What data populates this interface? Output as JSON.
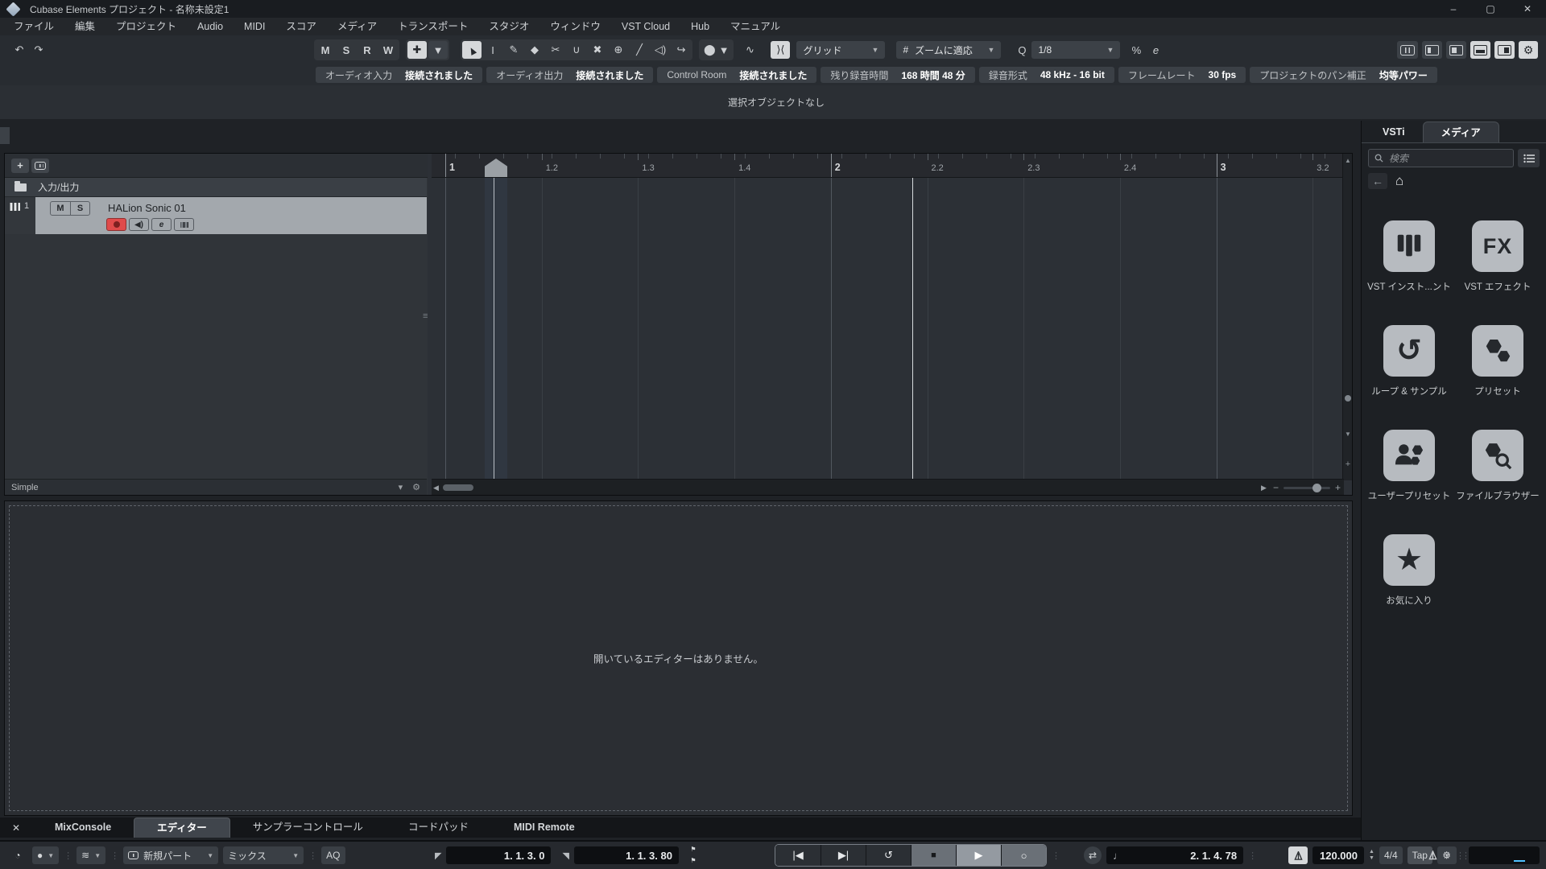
{
  "window": {
    "title": "Cubase Elements プロジェクト - 名称未設定1",
    "minimize": "–",
    "maximize": "▢",
    "close": "✕"
  },
  "menu": {
    "items": [
      "ファイル",
      "編集",
      "プロジェクト",
      "Audio",
      "MIDI",
      "スコア",
      "メディア",
      "トランスポート",
      "スタジオ",
      "ウィンドウ",
      "VST Cloud",
      "Hub",
      "マニュアル"
    ]
  },
  "toolbar": {
    "undo": "↶",
    "redo": "↷",
    "msrw": [
      "M",
      "S",
      "R",
      "W"
    ],
    "autoscroll_glyph": "✚",
    "tools": [
      {
        "name": "object-select-tool",
        "glyph": "▲",
        "arrow": true,
        "active": true
      },
      {
        "name": "range-select-tool",
        "glyph": "I"
      },
      {
        "name": "draw-tool",
        "glyph": "✎"
      },
      {
        "name": "erase-tool",
        "glyph": "◆"
      },
      {
        "name": "split-tool",
        "glyph": "✂"
      },
      {
        "name": "glue-tool",
        "glyph": "∪"
      },
      {
        "name": "mute-tool",
        "glyph": "✖"
      },
      {
        "name": "zoom-tool",
        "glyph": "⊕"
      },
      {
        "name": "line-tool",
        "glyph": "╱"
      },
      {
        "name": "play-tool",
        "glyph": "◁)"
      },
      {
        "name": "scrub-tool",
        "glyph": "↪"
      }
    ],
    "color_menu_glyph": "⬤",
    "crossfade_glyph": "∿",
    "snap_glyph": "⟩⟨",
    "grid_type_label": "グリッド",
    "grid_interval_icon": "#",
    "grid_interval_label": "ズームに適応",
    "quantize_icon": "Q",
    "quantize_label": "1/8",
    "iterative_quantize": "%",
    "quantize_panel": "e",
    "zones": [
      {
        "name": "keyboard-zone-icon",
        "type": "kbd",
        "active": false
      },
      {
        "name": "left-zone-toggle",
        "type": "zone-l",
        "active": false
      },
      {
        "name": "left-zone-alt-toggle",
        "type": "zone-l2",
        "active": false
      },
      {
        "name": "lower-zone-toggle",
        "type": "zone-b",
        "active": true
      },
      {
        "name": "right-zone-toggle",
        "type": "zone-r",
        "active": true
      },
      {
        "name": "setup-window-layout",
        "type": "gear",
        "active": true
      }
    ]
  },
  "info_line": {
    "segments": [
      {
        "label": "オーディオ入力",
        "value": "接続されました"
      },
      {
        "label": "オーディオ出力",
        "value": "接続されました"
      },
      {
        "label": "Control Room",
        "value": "接続されました"
      },
      {
        "label": "残り録音時間",
        "value": "168 時間 48 分"
      },
      {
        "label": "録音形式",
        "value": "48 kHz - 16 bit"
      },
      {
        "label": "フレームレート",
        "value": "30 fps"
      },
      {
        "label": "プロジェクトのパン補正",
        "value": "均等パワー"
      }
    ],
    "status": "選択オブジェクトなし"
  },
  "left_zone": {
    "add_label": "+",
    "folder_label": "入力/出力",
    "track": {
      "number": "1",
      "name": "HALion Sonic 01",
      "mute": "M",
      "solo": "S",
      "edit": "e"
    },
    "footer_label": "Simple"
  },
  "ruler": {
    "ticks": [
      "1",
      "1.2",
      "1.3",
      "1.4",
      "2",
      "2.2",
      "2.3",
      "2.4",
      "3",
      "3.2"
    ]
  },
  "lower_zone": {
    "empty_text": "開いているエディターはありません。"
  },
  "bottom_tabs": {
    "close": "✕",
    "tabs": [
      {
        "label": "MixConsole",
        "bold": true
      },
      {
        "label": "エディター",
        "active": true
      },
      {
        "label": "サンプラーコントロール"
      },
      {
        "label": "コードパッド"
      },
      {
        "label": "MIDI Remote",
        "bold": true
      }
    ]
  },
  "right_zone": {
    "tabs": [
      {
        "label": "VSTi"
      },
      {
        "label": "メディア",
        "active": true
      }
    ],
    "search_placeholder": "検索",
    "tiles": [
      {
        "icon": "piano",
        "label": "VST インスト...ント"
      },
      {
        "icon": "fx",
        "label": "VST エフェクト"
      },
      {
        "icon": "loop",
        "label": "ループ & サンプル"
      },
      {
        "icon": "presets",
        "label": "プリセット"
      },
      {
        "icon": "user",
        "label": "ユーザープリセット"
      },
      {
        "icon": "browser",
        "label": "ファイルブラウザー"
      },
      {
        "icon": "star",
        "label": "お気に入り"
      }
    ]
  },
  "transport": {
    "constrain_glyph": "◔",
    "record_mode_glyph": "●",
    "audio_record_glyph": "≋",
    "midi_part_label": "新規パート",
    "midi_mix_label": "ミックス",
    "aq_label": "AQ",
    "left_locator": "1. 1. 3.   0",
    "right_locator": "1. 1. 3.  80",
    "prev": "|◀",
    "next": "▶|",
    "cycle": "↺",
    "stop": "■",
    "play": "▶",
    "record": "○",
    "exchange_glyph": "⇄",
    "note_glyph": "♩",
    "time_display": "2. 1. 4. 78",
    "tempo": "120.000",
    "signature": "4/4",
    "tap_label": "Tap"
  },
  "colors": {
    "record_red": "#e04b4b",
    "meter_cyan": "#4fc1ff",
    "selection": "#d6d8da"
  }
}
